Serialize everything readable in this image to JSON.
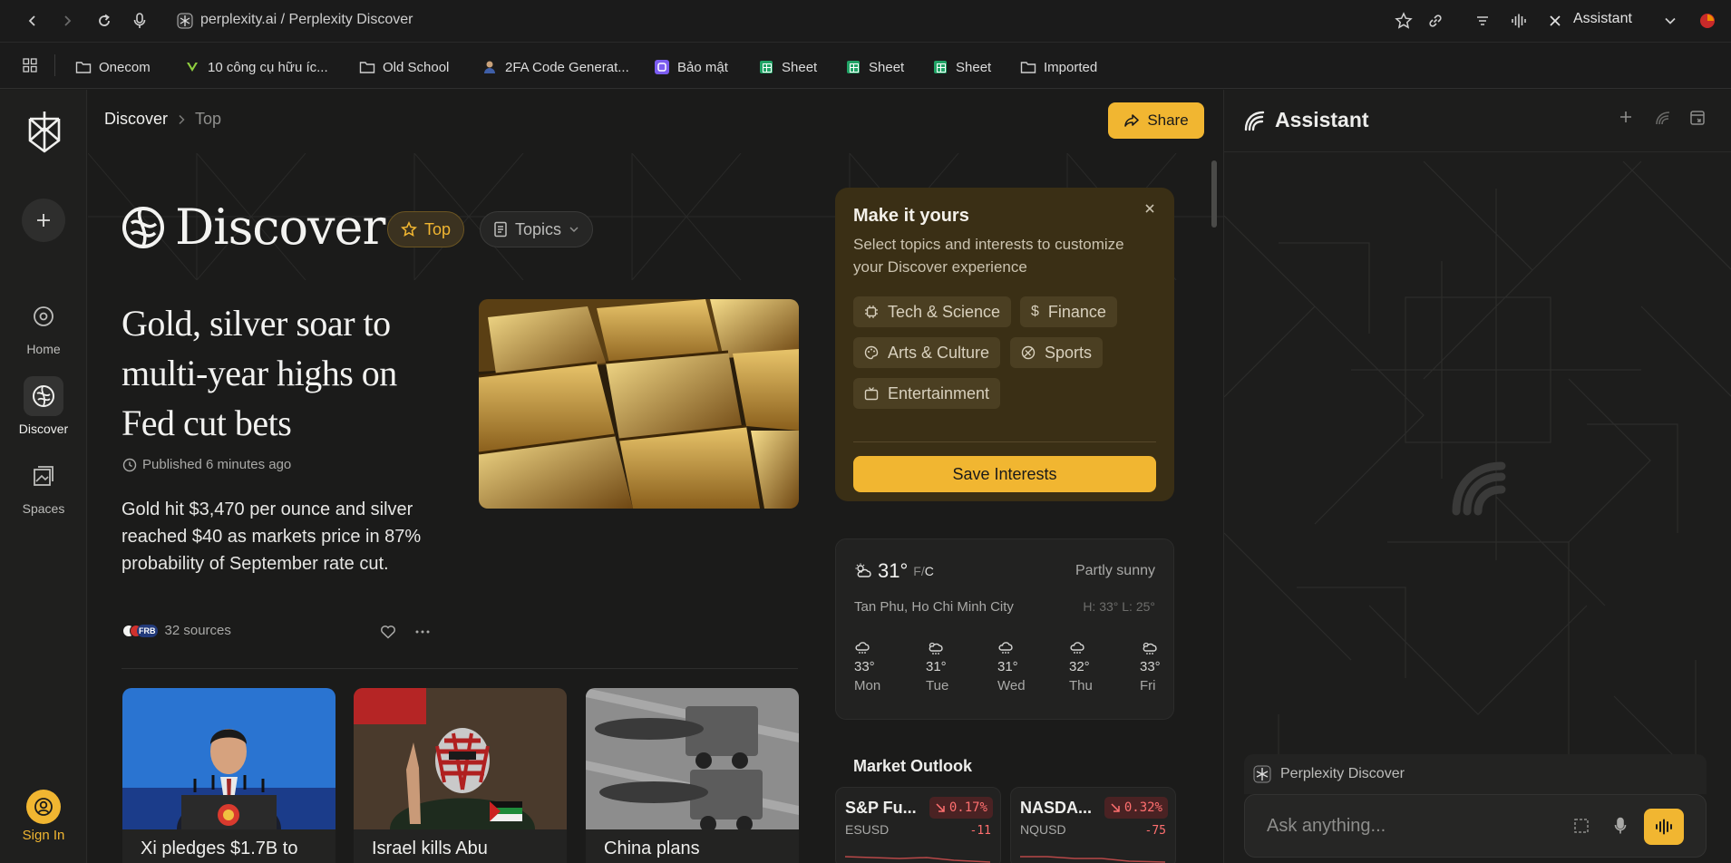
{
  "browser": {
    "url": "perplexity.ai / Perplexity Discover",
    "assistant_tab": "Assistant"
  },
  "bookmarks": [
    {
      "label": "Onecom",
      "icon": "folder-icon"
    },
    {
      "label": "10 công cụ hữu íc...",
      "icon": "vue-icon"
    },
    {
      "label": "Old School",
      "icon": "folder-icon"
    },
    {
      "label": "2FA Code Generat...",
      "icon": "user-icon"
    },
    {
      "label": "Bảo mật",
      "icon": "security-app-icon"
    },
    {
      "label": "Sheet",
      "icon": "sheets-icon"
    },
    {
      "label": "Sheet",
      "icon": "sheets-icon"
    },
    {
      "label": "Sheet",
      "icon": "sheets-icon"
    },
    {
      "label": "Imported",
      "icon": "folder-icon"
    }
  ],
  "rail": {
    "items": [
      {
        "label": "Home",
        "icon": "search-icon"
      },
      {
        "label": "Discover",
        "icon": "globe-icon"
      },
      {
        "label": "Spaces",
        "icon": "spaces-icon"
      }
    ],
    "sign_in": "Sign In"
  },
  "breadcrumb": {
    "section": "Discover",
    "current": "Top"
  },
  "share_label": "Share",
  "discover": {
    "wordmark": "Discover",
    "tabs": {
      "top": "Top",
      "topics": "Topics"
    }
  },
  "feature": {
    "headline": "Gold, silver soar to multi-year highs on Fed cut bets",
    "published": "Published 6 minutes ago",
    "summary": "Gold hit $3,470 per ounce and silver reached $40 as markets price in 87% probability of September rate cut.",
    "sources": "32 sources",
    "source_badge": "FRB"
  },
  "cards": [
    {
      "caption": "Xi pledges $1.7B to"
    },
    {
      "caption": "Israel kills Abu"
    },
    {
      "caption": "China plans"
    }
  ],
  "make_it_yours": {
    "title": "Make it yours",
    "subtitle": "Select topics and interests to customize your Discover experience",
    "chips": [
      "Tech & Science",
      "Finance",
      "Arts & Culture",
      "Sports",
      "Entertainment"
    ],
    "save": "Save Interests"
  },
  "weather": {
    "temp": "31°",
    "unit_f": "F",
    "unit_c": "C",
    "condition": "Partly sunny",
    "location": "Tan Phu, Ho Chi Minh City",
    "hilo": "H: 33° L: 25°",
    "days": [
      {
        "temp": "33°",
        "name": "Mon",
        "icon": "rain-cloud-icon"
      },
      {
        "temp": "31°",
        "name": "Tue",
        "icon": "sun-cloud-rain-icon"
      },
      {
        "temp": "31°",
        "name": "Wed",
        "icon": "rain-cloud-icon"
      },
      {
        "temp": "32°",
        "name": "Thu",
        "icon": "rain-cloud-icon"
      },
      {
        "temp": "33°",
        "name": "Fri",
        "icon": "sun-cloud-rain-icon"
      }
    ]
  },
  "market": {
    "title": "Market Outlook",
    "tickers": [
      {
        "name": "S&P Fu...",
        "symbol": "ESUSD",
        "change_pct": "0.17%",
        "change_abs": "-11"
      },
      {
        "name": "NASDA...",
        "symbol": "NQUSD",
        "change_pct": "0.32%",
        "change_abs": "-75"
      }
    ]
  },
  "assistant": {
    "title": "Assistant",
    "context": "Perplexity Discover",
    "placeholder": "Ask anything..."
  },
  "colors": {
    "accent": "#f1b631",
    "negative": "#ff6f6f",
    "panel_warm": "#3a2f15"
  }
}
